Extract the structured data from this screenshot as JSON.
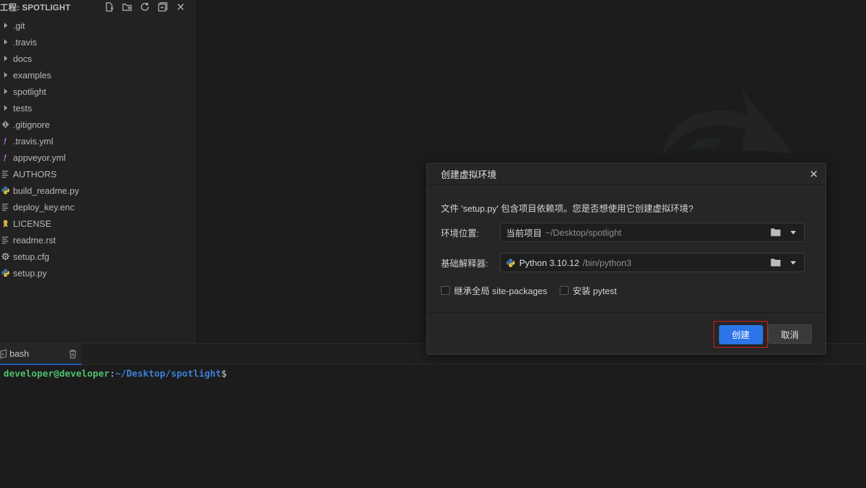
{
  "explorer": {
    "title": "工程: SPOTLIGHT",
    "items": [
      {
        "label": ".git",
        "type": "folder"
      },
      {
        "label": ".travis",
        "type": "folder"
      },
      {
        "label": "docs",
        "type": "folder"
      },
      {
        "label": "examples",
        "type": "folder"
      },
      {
        "label": "spotlight",
        "type": "folder"
      },
      {
        "label": "tests",
        "type": "folder"
      },
      {
        "label": ".gitignore",
        "type": "git-icon"
      },
      {
        "label": ".travis.yml",
        "type": "yaml-icon"
      },
      {
        "label": "appveyor.yml",
        "type": "yaml-icon"
      },
      {
        "label": "AUTHORS",
        "type": "text-icon"
      },
      {
        "label": "build_readme.py",
        "type": "python-icon"
      },
      {
        "label": "deploy_key.enc",
        "type": "text-icon"
      },
      {
        "label": "LICENSE",
        "type": "license-icon"
      },
      {
        "label": "readme.rst",
        "type": "text-icon"
      },
      {
        "label": "setup.cfg",
        "type": "gear-icon"
      },
      {
        "label": "setup.py",
        "type": "python-icon"
      }
    ]
  },
  "terminal": {
    "tab_label": "bash",
    "prompt_user": "developer@developer",
    "prompt_colon": ":",
    "prompt_path": "~/Desktop/spotlight",
    "prompt_dollar": "$"
  },
  "dialog": {
    "title": "创建虚拟环境",
    "message": "文件 'setup.py' 包含项目依赖项。您是否想使用它创建虚拟环境?",
    "location_label": "环境位置:",
    "location_main": "当前项目",
    "location_path": "~/Desktop/spotlight",
    "interpreter_label": "基础解释器:",
    "interpreter_main": "Python 3.10.12",
    "interpreter_path": "/bin/python3",
    "inherit_label": "继承全局 site-packages",
    "pytest_label": "安装 pytest",
    "create_label": "创建",
    "cancel_label": "取消"
  },
  "colors": {
    "accent": "#2c74e8",
    "highlight": "#e01a1a",
    "prompt_user": "#4fbf6e",
    "prompt_path": "#3f80d6"
  }
}
